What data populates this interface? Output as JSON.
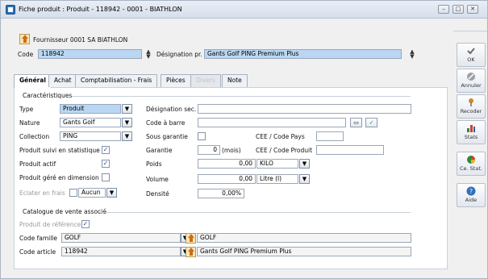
{
  "window": {
    "title": "Fiche produit : Produit - 118942 - 0001 - BIATHLON",
    "controls": [
      "–",
      "□",
      "✕"
    ]
  },
  "header": {
    "fournisseur": "Fournisseur  0001 SA BIATHLON",
    "code_label": "Code",
    "code_value": "118942",
    "designation_label": "Désignation pr.",
    "designation_value": "Gants Golf PING Premium Plus"
  },
  "tabs": [
    {
      "label": "Général",
      "state": "active"
    },
    {
      "label": "Achat",
      "state": "normal"
    },
    {
      "label": "Comptabilisation - Frais",
      "state": "normal"
    },
    {
      "label": "Pièces",
      "state": "normal"
    },
    {
      "label": "Divers",
      "state": "disabled"
    },
    {
      "label": "Note",
      "state": "normal"
    }
  ],
  "caracteristiques": {
    "section_title": "Caractéristiques",
    "type_label": "Type",
    "type_value": "Produit",
    "nature_label": "Nature",
    "nature_value": "Gants Golf",
    "collection_label": "Collection",
    "collection_value": "PING",
    "suivi_label": "Produit suivi en statistique",
    "suivi_checked": true,
    "actif_label": "Produit actif",
    "actif_checked": true,
    "dimension_label": "Produit géré en dimension",
    "dimension_checked": false,
    "eclater_label": "Eclater en frais",
    "eclater_checked": false,
    "eclater_value": "Aucun",
    "designation_sec_label": "Désignation sec.",
    "designation_sec_value": "",
    "code_barre_label": "Code à barre",
    "code_barre_value": "",
    "sous_garantie_label": "Sous garantie",
    "sous_garantie_checked": false,
    "garantie_label": "Garantie",
    "garantie_value": "0",
    "garantie_unit": "(mois)",
    "poids_label": "Poids",
    "poids_value": "0,00",
    "poids_unit": "KILO",
    "volume_label": "Volume",
    "volume_value": "0,00",
    "volume_unit": "Litre (l)",
    "densite_label": "Densité",
    "densite_value": "0,00%",
    "cee_pays_label": "CEE / Code Pays",
    "cee_pays_value": "",
    "cee_produit_label": "CEE / Code Produit",
    "cee_produit_value": ""
  },
  "catalogue": {
    "section_title": "Catalogue de vente associé",
    "produit_ref_label": "Produit de référence",
    "produit_ref_checked": true,
    "code_famille_label": "Code famille",
    "code_famille_value": "GOLF",
    "famille_desc": "GOLF",
    "code_article_label": "Code article",
    "code_article_value": "118942",
    "article_desc": "Gants Golf PING Premium Plus"
  },
  "sidebar": [
    {
      "label": "OK",
      "icon": "checkmark-icon"
    },
    {
      "label": "Annuler",
      "icon": "cancel-icon"
    },
    {
      "label": "Recoder",
      "icon": "pin-icon"
    },
    {
      "label": "Stats",
      "icon": "bar-chart-icon"
    },
    {
      "label": "Ce. Stat.",
      "icon": "pie-chart-icon"
    },
    {
      "label": "Aide",
      "icon": "help-icon"
    }
  ],
  "colors": {
    "accent_blue": "#b9d7f3",
    "window_border": "#aab4c3"
  }
}
